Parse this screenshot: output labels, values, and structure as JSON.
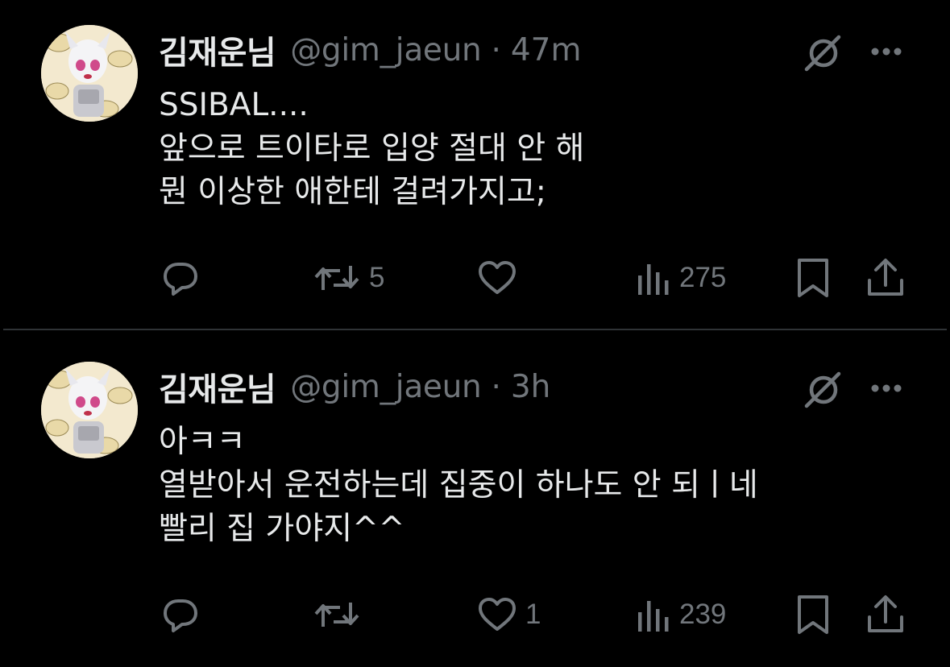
{
  "tweets": [
    {
      "display_name": "김재운님",
      "handle": "@gim_jaeun",
      "separator": "·",
      "time": "47m",
      "lines": [
        "SSIBAL....",
        "앞으로 트이타로 입양 절대 안 해",
        "뭔 이상한 애한테 걸려가지고;"
      ],
      "reply_count": "",
      "retweet_count": "5",
      "like_count": "",
      "view_count": "275"
    },
    {
      "display_name": "김재운님",
      "handle": "@gim_jaeun",
      "separator": "·",
      "time": "3h",
      "lines": [
        "아ㅋㅋ",
        "열받아서 운전하는데 집중이 하나도 안 되ㅣ네",
        "빨리 집 가야지^^"
      ],
      "reply_count": "",
      "retweet_count": "",
      "like_count": "1",
      "view_count": "239"
    }
  ],
  "icons": {
    "avatar": "avatar-image",
    "grok": "grok-icon",
    "more": "more-icon",
    "reply": "reply-icon",
    "retweet": "retweet-icon",
    "like": "heart-icon",
    "views": "views-icon",
    "bookmark": "bookmark-icon",
    "share": "share-icon"
  },
  "colors": {
    "background": "#000000",
    "text_primary": "#e7e9ea",
    "text_secondary": "#71767b",
    "divider": "#2f3336"
  }
}
